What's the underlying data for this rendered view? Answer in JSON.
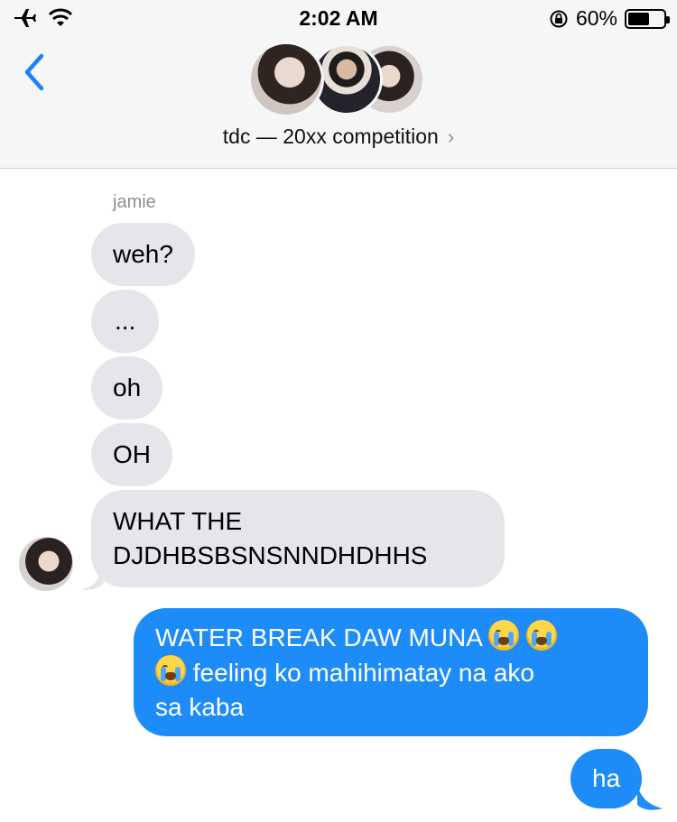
{
  "status_bar": {
    "time": "2:02 AM",
    "battery": "60%",
    "battery_level": 0.6
  },
  "header": {
    "title": "tdc — 20xx competition",
    "chevron": "›",
    "avatars": [
      "group-member-avatar-1",
      "group-member-avatar-2",
      "group-member-avatar-3"
    ]
  },
  "thread": {
    "sender_name": "jamie",
    "incoming": [
      "weh?",
      "...",
      "oh",
      "OH",
      "WHAT THE",
      "DJDHBSBSNSNNDHDHHS"
    ],
    "outgoing": [
      {
        "line1": "WATER BREAK DAW MUNA",
        "line2": "feeling ko mahihimatay na ako",
        "line3": "sa kaba",
        "emoji": "loudly-crying-face"
      },
      {
        "text": "ha"
      }
    ]
  },
  "colors": {
    "incoming_bubble": "#e5e5ea",
    "outgoing_bubble": "#1d8cf8",
    "accent": "#1a82fb"
  }
}
